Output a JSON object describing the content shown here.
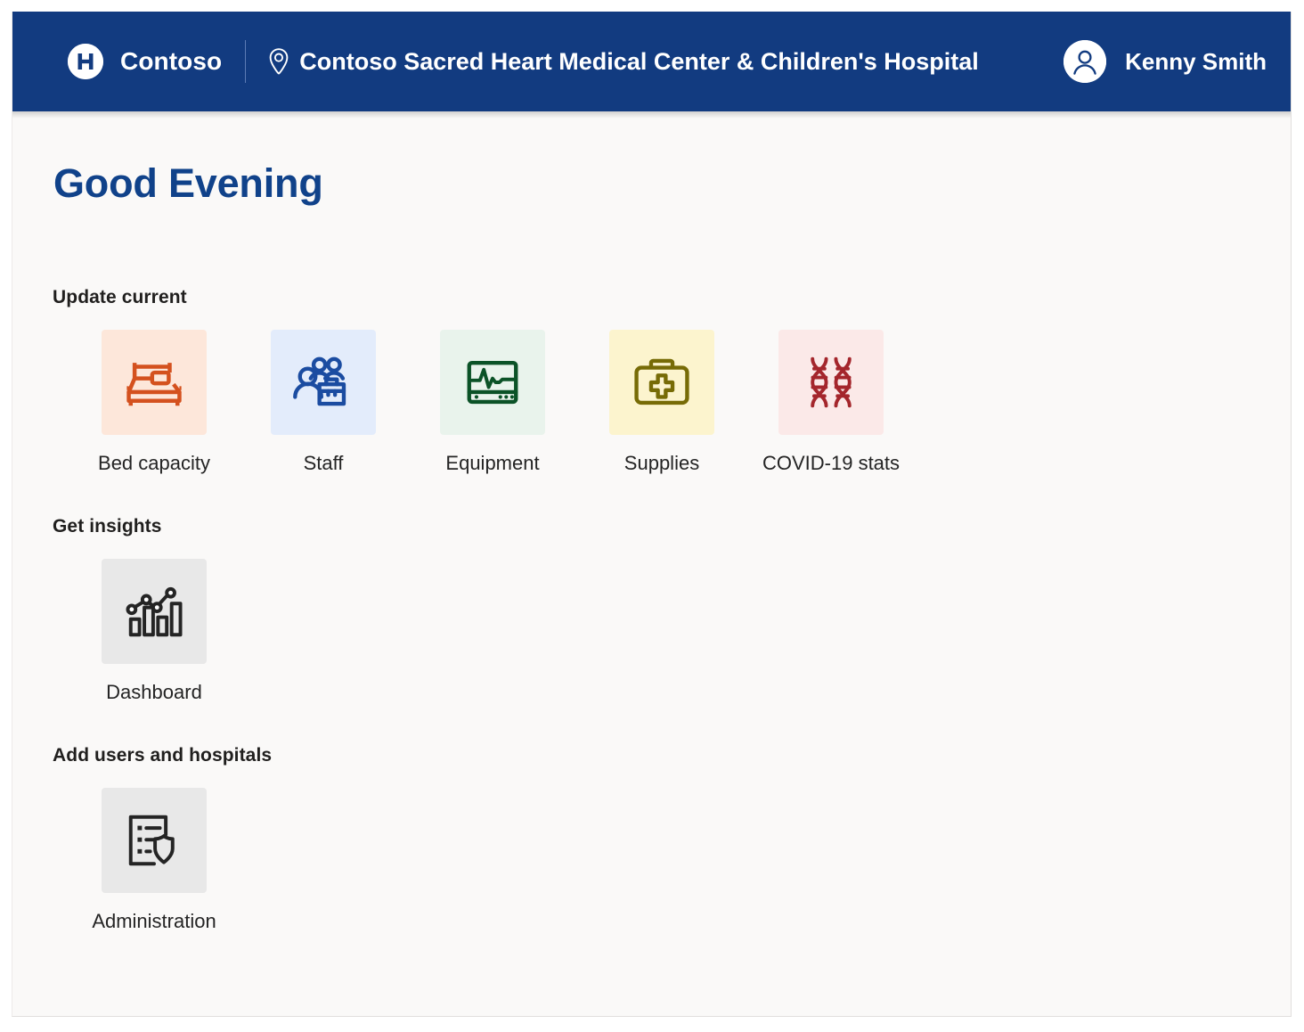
{
  "header": {
    "logo_icon": "hospital-h-logo-icon",
    "brand": "Contoso",
    "location_icon": "location-pin-icon",
    "site": "Contoso Sacred Heart Medical Center & Children's Hospital",
    "avatar_icon": "person-avatar-icon",
    "user": "Kenny Smith",
    "bg_color": "#123B80"
  },
  "main": {
    "greeting": "Good Evening",
    "greeting_color": "#10428a",
    "sections": [
      {
        "title": "Update current",
        "tiles": [
          {
            "label": "Bed capacity",
            "icon": "bed-icon",
            "fg": "#D4511E",
            "bg": "#FDE7DA"
          },
          {
            "label": "Staff",
            "icon": "staff-group-icon",
            "fg": "#1B4CA1",
            "bg": "#E3ECFB"
          },
          {
            "label": "Equipment",
            "icon": "heart-monitor-icon",
            "fg": "#0B5227",
            "bg": "#E9F3EC"
          },
          {
            "label": "Supplies",
            "icon": "first-aid-kit-icon",
            "fg": "#776B06",
            "bg": "#FCF4CE"
          },
          {
            "label": "COVID-19 stats",
            "icon": "dna-helix-icon",
            "fg": "#A4262C",
            "bg": "#FBE9E8"
          }
        ]
      },
      {
        "title": "Get insights",
        "tiles": [
          {
            "label": "Dashboard",
            "icon": "bar-chart-trend-icon",
            "fg": "#242424",
            "bg": "#E8E8E8"
          }
        ]
      },
      {
        "title": "Add users and hospitals",
        "tiles": [
          {
            "label": "Administration",
            "icon": "document-shield-icon",
            "fg": "#242424",
            "bg": "#E8E8E8"
          }
        ]
      }
    ]
  }
}
